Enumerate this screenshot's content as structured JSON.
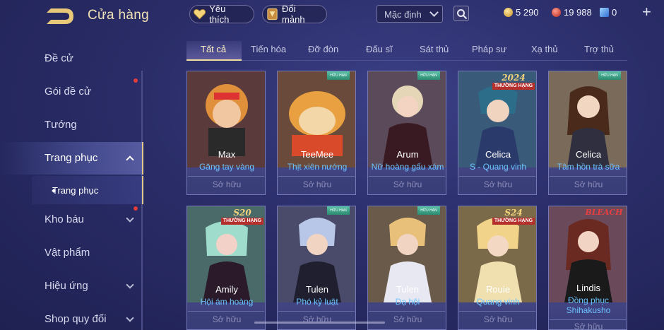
{
  "header": {
    "title": "Cửa hàng",
    "favorites_label": "Yêu thích",
    "shards_label": "Đổi mảnh",
    "sort_value": "Mặc định",
    "currency": {
      "gold": "5 290",
      "red": "19 988",
      "blue": "0"
    }
  },
  "sidebar": {
    "items": [
      {
        "label": "Đề cử"
      },
      {
        "label": "Gói đề cử"
      },
      {
        "label": "Tướng"
      },
      {
        "label": "Trang phục"
      },
      {
        "label": "Kho báu"
      },
      {
        "label": "Vật phẩm"
      },
      {
        "label": "Hiệu ứng"
      },
      {
        "label": "Shop quy đổi"
      }
    ],
    "sub_item": "Trang phục"
  },
  "tabs": [
    "Tất cả",
    "Tiến hóa",
    "Đỡ đòn",
    "Đấu sĩ",
    "Sát thủ",
    "Pháp sư",
    "Xạ thủ",
    "Trợ thủ"
  ],
  "cards": [
    {
      "hero": "Max",
      "skin": "Găng tay vàng",
      "status": "Sở hữu"
    },
    {
      "hero": "TeeMee",
      "skin": "Thịt xiên nướng",
      "status": "Sở hữu",
      "badge": "HỮU HẠN"
    },
    {
      "hero": "Arum",
      "skin": "Nữ hoàng gấu xám",
      "status": "Sở hữu",
      "badge": "HỮU HẠN"
    },
    {
      "hero": "Celica",
      "skin": "S - Quang vinh",
      "status": "Sở hữu",
      "rank_badge": "THƯỜNG HẠNG",
      "rank_text": "2024"
    },
    {
      "hero": "Celica",
      "skin": "Tâm hồn trà sữa",
      "status": "Sở hữu",
      "badge": "HỮU HẠN"
    },
    {
      "hero": "Amily",
      "skin": "Hội ám hoàng",
      "status": "Sở hữu",
      "rank_badge": "THƯỜNG HẠNG",
      "rank_text": "S20"
    },
    {
      "hero": "Tulen",
      "skin": "Phó kỷ luật",
      "status": "Sở hữu",
      "badge": "HỮU HẠN"
    },
    {
      "hero": "Tulen",
      "skin": "Dạ hội",
      "status": "Sở hữu",
      "badge": "HỮU HẠN"
    },
    {
      "hero": "Rouie",
      "skin": "Quang vinh",
      "status": "Sở hữu",
      "rank_badge": "THƯỜNG HẠNG",
      "rank_text": "S24"
    },
    {
      "hero": "Lindis",
      "skin": "Đồng phục Shihakusho",
      "status": "Sở hữu",
      "badge_text": "BLEACH"
    }
  ],
  "colors": {
    "accent_gold": "#f0dda0",
    "skin_name_blue": "#6bc3ff",
    "notification_red": "#e23b3b"
  }
}
